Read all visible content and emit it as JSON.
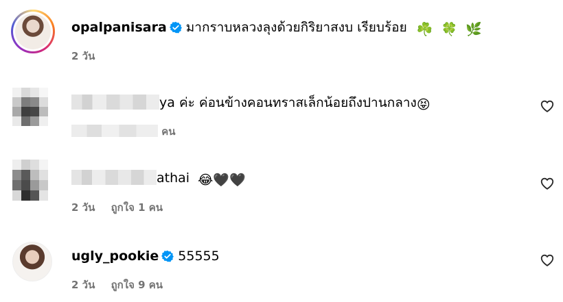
{
  "comments": [
    {
      "username": "opalpanisara",
      "verified": true,
      "text": "มากราบหลวงลุงด้วยกิริยาสงบ เรียบร้อย",
      "emojis": [
        "☘️",
        "🍀",
        "🌿"
      ],
      "time": "2 วัน",
      "likes_text": ""
    },
    {
      "username_visible": "ya",
      "text": "ค่ะ ค่อนข้างคอนทราสเล็กน้อยถึงปานกลาง",
      "emojis": [
        "😝"
      ],
      "time": "",
      "likes_text": "คน"
    },
    {
      "username_visible": "athai",
      "text": "",
      "emojis": [
        "😂",
        "🖤",
        "🖤"
      ],
      "time": "2 วัน",
      "likes_text": "ถูกใจ 1 คน"
    },
    {
      "username": "ugly_pookie",
      "verified": true,
      "text": "55555",
      "emojis": [],
      "time": "2 วัน",
      "likes_text": "ถูกใจ 9 คน"
    }
  ],
  "icons": {
    "verified": "verified-badge-icon",
    "like": "heart-outline-icon"
  },
  "colors": {
    "verified": "#0095f6",
    "meta": "#737373"
  }
}
